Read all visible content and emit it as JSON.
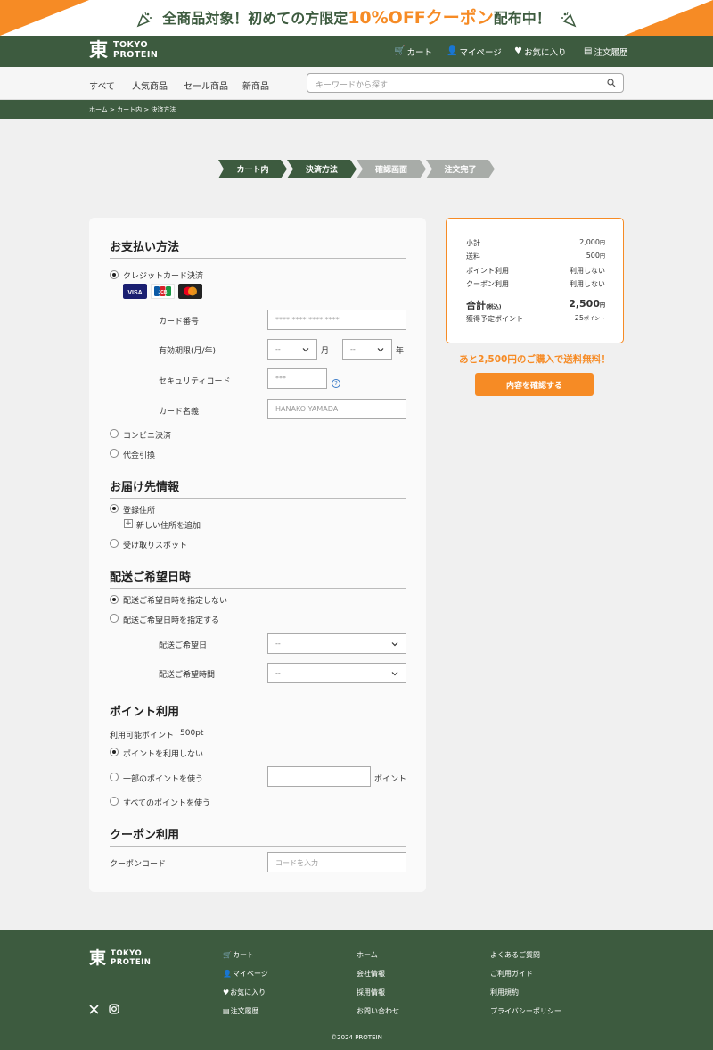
{
  "banner": {
    "text_a": "全商品対象！初めての方限定",
    "highlight": "10%OFFクーポン",
    "text_b": "配布中！"
  },
  "logo": {
    "mark": "東",
    "line1": "TOKYO",
    "line2": "PROTEIN"
  },
  "header_nav": [
    {
      "label": "カート",
      "icon": "cart-icon"
    },
    {
      "label": "マイページ",
      "icon": "person-icon"
    },
    {
      "label": "お気に入り",
      "icon": "heart-icon"
    },
    {
      "label": "注文履歴",
      "icon": "history-icon"
    }
  ],
  "categories": [
    "すべて",
    "人気商品",
    "セール商品",
    "新商品"
  ],
  "search": {
    "placeholder": "キーワードから探す"
  },
  "breadcrumb": "ホーム > カート内 > 決済方法",
  "steps": [
    "カート内",
    "決済方法",
    "確認画面",
    "注文完了"
  ],
  "payment": {
    "title": "お支払い方法",
    "credit_label": "クレジットカード決済",
    "cards": [
      "VISA",
      "JCB",
      "Mastercard"
    ],
    "card_number_label": "カード番号",
    "card_number_placeholder": "**** **** **** ****",
    "expiry_label": "有効期限(月/年)",
    "month_value": "--",
    "month_unit": "月",
    "year_value": "--",
    "year_unit": "年",
    "cvc_label": "セキュリティコード",
    "cvc_placeholder": "***",
    "help_mark": "?",
    "name_label": "カード名義",
    "name_placeholder": "HANAKO YAMADA",
    "convenience_label": "コンビニ決済",
    "cod_label": "代金引換"
  },
  "delivery": {
    "title": "お届け先情報",
    "registered": "登録住所",
    "add_new": "新しい住所を追加",
    "pickup": "受け取りスポット"
  },
  "schedule": {
    "title": "配送ご希望日時",
    "no_specify": "配送ご希望日時を指定しない",
    "specify": "配送ご希望日時を指定する",
    "date_label": "配送ご希望日",
    "date_value": "--",
    "time_label": "配送ご希望時間",
    "time_value": "--"
  },
  "points": {
    "title": "ポイント利用",
    "available_label": "利用可能ポイント",
    "available_value": "500pt",
    "no_use": "ポイントを利用しない",
    "partial": "一部のポイントを使う",
    "unit": "ポイント",
    "all": "すべてのポイントを使う"
  },
  "coupon": {
    "title": "クーポン利用",
    "code_label": "クーポンコード",
    "placeholder": "コードを入力"
  },
  "summary": {
    "subtotal_label": "小計",
    "subtotal": "2,000",
    "yen": "円",
    "shipping_label": "送料",
    "shipping": "500",
    "points_label": "ポイント利用",
    "points_value": "利用しない",
    "coupon_label": "クーポン利用",
    "coupon_value": "利用しない",
    "total_label": "合計",
    "tax_note": "(税込)",
    "total": "2,500",
    "earn_label": "獲得予定ポイント",
    "earn": "25",
    "earn_unit": "ポイント"
  },
  "free_shipping_note": "あと2,500円のご購入で送料無料！",
  "confirm_button": "内容を確認する",
  "footer": {
    "col1": [
      {
        "label": "カート",
        "icon": "cart-icon"
      },
      {
        "label": "マイページ",
        "icon": "person-icon"
      },
      {
        "label": "お気に入り",
        "icon": "heart-icon"
      },
      {
        "label": "注文履歴",
        "icon": "history-icon"
      }
    ],
    "col2": [
      "ホーム",
      "会社情報",
      "採用情報",
      "お問い合わせ"
    ],
    "col3": [
      "よくあるご質問",
      "ご利用ガイド",
      "利用規約",
      "プライバシーポリシー"
    ],
    "social": [
      "x-icon",
      "instagram-icon"
    ],
    "copyright": "©2024 PROTEIN"
  },
  "colors": {
    "brand_green": "#3d5b3f",
    "accent_orange": "#f68b25",
    "step_inactive": "#a8aca8"
  }
}
